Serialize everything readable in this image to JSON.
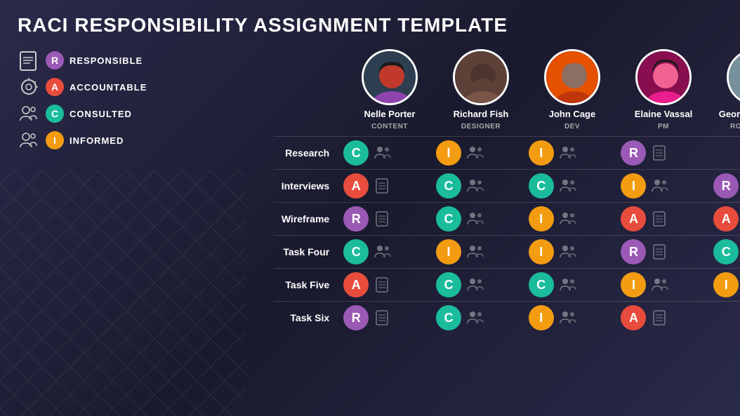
{
  "title": "RACI RESPONSIBILITY ASSIGNMENT TEMPLATE",
  "legend": {
    "items": [
      {
        "id": "responsible",
        "letter": "R",
        "label": "RESPONSIBLE",
        "color": "#9b59b6",
        "icon": "document-icon"
      },
      {
        "id": "accountable",
        "letter": "A",
        "label": "ACCOUNTABLE",
        "color": "#e74c3c",
        "icon": "magnify-icon"
      },
      {
        "id": "consulted",
        "letter": "C",
        "label": "CONSULTED",
        "color": "#1abc9c",
        "icon": "group-icon"
      },
      {
        "id": "informed",
        "letter": "I",
        "label": "INFORMED",
        "color": "#f39c12",
        "icon": "group-icon2"
      }
    ]
  },
  "persons": [
    {
      "id": "nelle",
      "name": "Nelle Porter",
      "role": "CONTENT",
      "avatarClass": "avatar-nelle"
    },
    {
      "id": "richard",
      "name": "Richard Fish",
      "role": "DESIGNER",
      "avatarClass": "avatar-richard"
    },
    {
      "id": "john",
      "name": "John Cage",
      "role": "DEV",
      "avatarClass": "avatar-john"
    },
    {
      "id": "elaine",
      "name": "Elaine Vassal",
      "role": "PM",
      "avatarClass": "avatar-elaine"
    },
    {
      "id": "georgia",
      "name": "Georgia Thomas",
      "role": "ROLE / TITLE",
      "avatarClass": "avatar-georgia"
    }
  ],
  "tasks": [
    {
      "label": "Research",
      "assignments": [
        {
          "letter": "C",
          "color": "#1abc9c",
          "hasIcon": true
        },
        {
          "letter": "I",
          "color": "#f39c12",
          "hasIcon": true
        },
        {
          "letter": "I",
          "color": "#f39c12",
          "hasIcon": true
        },
        {
          "letter": "R",
          "color": "#9b59b6",
          "hasIcon": true
        },
        {
          "letter": "",
          "color": "",
          "hasIcon": false
        }
      ]
    },
    {
      "label": "Interviews",
      "assignments": [
        {
          "letter": "A",
          "color": "#e74c3c",
          "hasIcon": true
        },
        {
          "letter": "C",
          "color": "#1abc9c",
          "hasIcon": true
        },
        {
          "letter": "C",
          "color": "#1abc9c",
          "hasIcon": true
        },
        {
          "letter": "I",
          "color": "#f39c12",
          "hasIcon": true
        },
        {
          "letter": "R",
          "color": "#9b59b6",
          "hasIcon": true
        }
      ]
    },
    {
      "label": "Wireframe",
      "assignments": [
        {
          "letter": "R",
          "color": "#9b59b6",
          "hasIcon": true
        },
        {
          "letter": "C",
          "color": "#1abc9c",
          "hasIcon": true
        },
        {
          "letter": "I",
          "color": "#f39c12",
          "hasIcon": true
        },
        {
          "letter": "A",
          "color": "#e74c3c",
          "hasIcon": true
        },
        {
          "letter": "A",
          "color": "#e74c3c",
          "hasIcon": true
        }
      ]
    },
    {
      "label": "Task Four",
      "assignments": [
        {
          "letter": "C",
          "color": "#1abc9c",
          "hasIcon": true
        },
        {
          "letter": "I",
          "color": "#f39c12",
          "hasIcon": true
        },
        {
          "letter": "I",
          "color": "#f39c12",
          "hasIcon": true
        },
        {
          "letter": "R",
          "color": "#9b59b6",
          "hasIcon": true
        },
        {
          "letter": "C",
          "color": "#1abc9c",
          "hasIcon": true
        }
      ]
    },
    {
      "label": "Task Five",
      "assignments": [
        {
          "letter": "A",
          "color": "#e74c3c",
          "hasIcon": true
        },
        {
          "letter": "C",
          "color": "#1abc9c",
          "hasIcon": true
        },
        {
          "letter": "C",
          "color": "#1abc9c",
          "hasIcon": true
        },
        {
          "letter": "I",
          "color": "#f39c12",
          "hasIcon": true
        },
        {
          "letter": "I",
          "color": "#f39c12",
          "hasIcon": true
        }
      ]
    },
    {
      "label": "Task Six",
      "assignments": [
        {
          "letter": "R",
          "color": "#9b59b6",
          "hasIcon": true
        },
        {
          "letter": "C",
          "color": "#1abc9c",
          "hasIcon": true
        },
        {
          "letter": "I",
          "color": "#f39c12",
          "hasIcon": true
        },
        {
          "letter": "A",
          "color": "#e74c3c",
          "hasIcon": true
        },
        {
          "letter": "",
          "color": "",
          "hasIcon": false
        }
      ]
    }
  ],
  "colors": {
    "responsible": "#9b59b6",
    "accountable": "#e74c3c",
    "consulted": "#1abc9c",
    "informed": "#f39c12",
    "background": "#1a1a2e"
  }
}
